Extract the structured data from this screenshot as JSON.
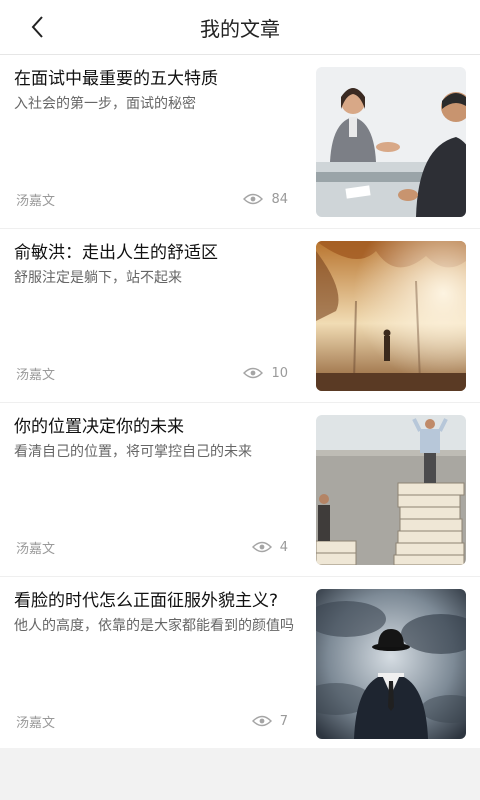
{
  "header": {
    "title": "我的文章"
  },
  "articles": [
    {
      "title": "在面试中最重要的五大特质",
      "subtitle": "入社会的第一步，面试的秘密",
      "author": "汤嘉文",
      "views": "84"
    },
    {
      "title": "俞敏洪：走出人生的舒适区",
      "subtitle": "舒服注定是躺下，站不起来",
      "author": "汤嘉文",
      "views": "10"
    },
    {
      "title": "你的位置决定你的未来",
      "subtitle": "看清自己的位置，将可掌控自己的未来",
      "author": "汤嘉文",
      "views": "4"
    },
    {
      "title": "看脸的时代怎么正面征服外貌主义?",
      "subtitle": "他人的高度，依靠的是大家都能看到的颜值吗",
      "author": "汤嘉文",
      "views": "7"
    }
  ],
  "icons": {
    "back": "back-arrow-icon",
    "views": "eye-icon"
  }
}
